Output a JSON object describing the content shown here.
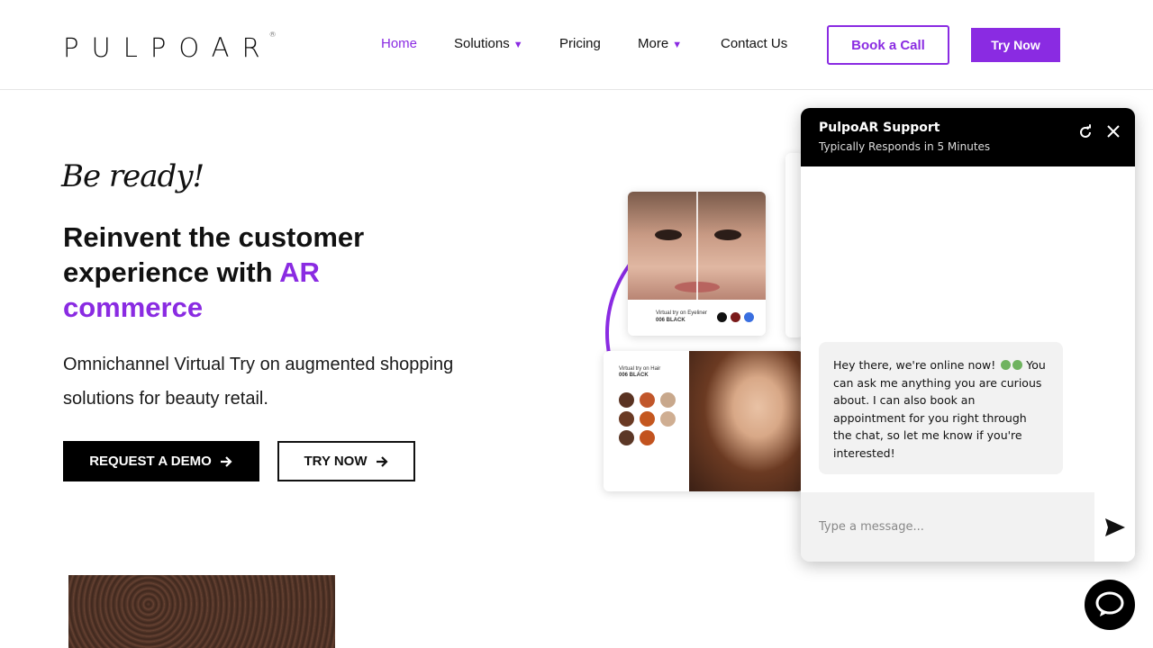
{
  "nav": {
    "logo": "PULPOAR",
    "logo_mark": "®",
    "links": [
      "Home",
      "Solutions",
      "Pricing",
      "More",
      "Contact Us"
    ],
    "book_call": "Book a Call",
    "try_now": "Try Now"
  },
  "hero": {
    "script_text": "Be ready!",
    "headline_1": "Reinvent the customer experience with ",
    "headline_highlight": "AR commerce",
    "subtext": "Omnichannel Virtual Try on augmented shopping solutions for beauty retail.",
    "demo_button": "REQUEST A DEMO",
    "try_button": "TRY NOW"
  },
  "ar_cards": {
    "eyeliner_label": "Virtual try on Eyeliner",
    "eyeliner_shade": "006 BLACK",
    "hair_label": "Virtual try on Hair",
    "hair_shade": "006 BLACK",
    "eyeliner_swatches": [
      "#111111",
      "#7a1a1a",
      "#3a6fe0"
    ],
    "hair_swatches": [
      "#5a3322",
      "#c1562a",
      "#c8a88c",
      "#6a3a24",
      "#c4571f",
      "#cfae92",
      "#5b3726",
      "#c2531f"
    ]
  },
  "chat": {
    "title": "PulpoAR Support",
    "subtitle": "Typically Responds in 5 Minutes",
    "message": "Hey there, we're online now! ",
    "message_rest": "You can ask me anything you are curious about. I can also book an appointment for you right through the chat, so let me know if you're interested!",
    "input_placeholder": "Type a message..."
  },
  "colors": {
    "accent": "#8a2be2",
    "online_dot": "#6fb35f"
  }
}
